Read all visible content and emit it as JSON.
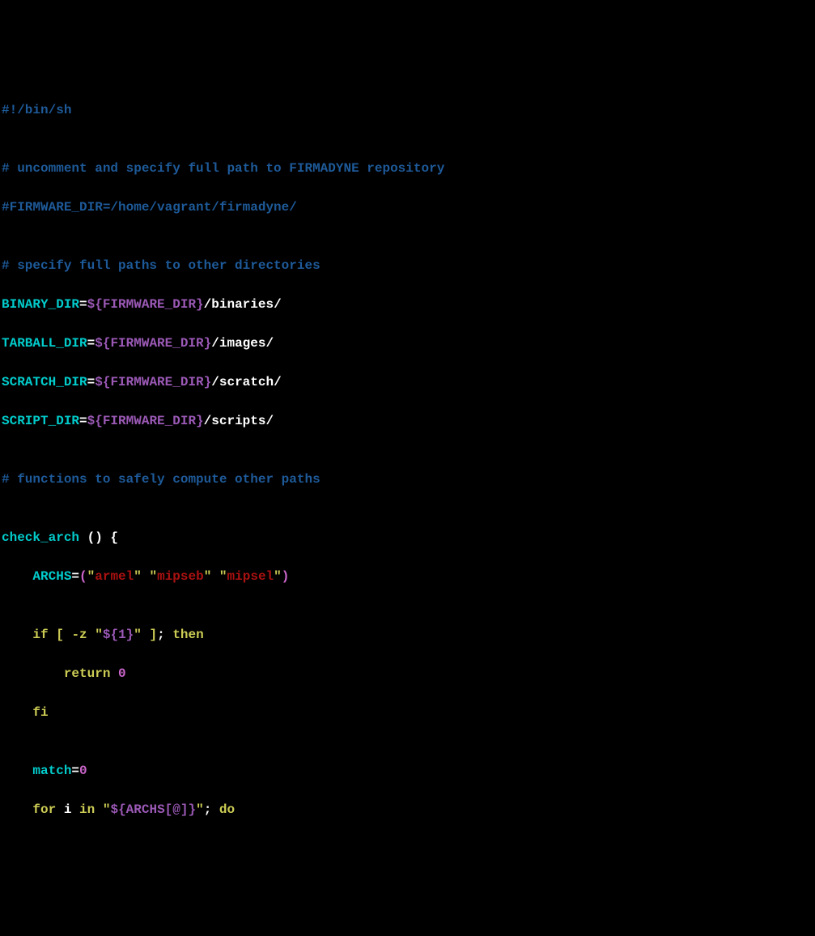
{
  "lines": {
    "l1_shebang": "#!/bin/sh",
    "l2_blank": "",
    "l3_comment": "# uncomment and specify full path to FIRMADYNE repository",
    "l4_comment": "#FIRMWARE_DIR=/home/vagrant/firmadyne/",
    "l5_blank": "",
    "l6_comment": "# specify full paths to other directories",
    "l7_var": "BINARY_DIR",
    "l7_eq": "=",
    "l7_exp": "${FIRMWARE_DIR}",
    "l7_tail": "/binaries/",
    "l8_var": "TARBALL_DIR",
    "l8_eq": "=",
    "l8_exp": "${FIRMWARE_DIR}",
    "l8_tail": "/images/",
    "l9_var": "SCRATCH_DIR",
    "l9_eq": "=",
    "l9_exp": "${FIRMWARE_DIR}",
    "l9_tail": "/scratch/",
    "l10_var": "SCRIPT_DIR",
    "l10_eq": "=",
    "l10_exp": "${FIRMWARE_DIR}",
    "l10_tail": "/scripts/",
    "l11_blank": "",
    "l12_comment": "# functions to safely compute other paths",
    "l13_blank": "",
    "l14_func": "check_arch ",
    "l14_paren": "()",
    "l14_brace": " {",
    "l15_indent": "    ",
    "l15_var": "ARCHS",
    "l15_eq": "=",
    "l15_popen": "(",
    "l15_q1a": "\"",
    "l15_s1": "armel",
    "l15_q1b": "\"",
    "l15_sp1": " ",
    "l15_q2a": "\"",
    "l15_s2": "mipseb",
    "l15_q2b": "\"",
    "l15_sp2": " ",
    "l15_q3a": "\"",
    "l15_s3": "mipsel",
    "l15_q3b": "\"",
    "l15_pclose": ")",
    "l16_blank": "",
    "l17_indent": "    ",
    "l17_if": "if",
    "l17_sp1": " ",
    "l17_br1": "[",
    "l17_sp2": " ",
    "l17_flag": "-z ",
    "l17_q1": "\"",
    "l17_exp": "${1}",
    "l17_q2": "\"",
    "l17_sp3": " ",
    "l17_br2": "]",
    "l17_semi": ";",
    "l17_sp4": " ",
    "l17_then": "then",
    "l18_indent": "        ",
    "l18_return": "return",
    "l18_sp": " ",
    "l18_zero": "0",
    "l19_indent": "    ",
    "l19_fi": "fi",
    "l20_blank": "",
    "l21_indent": "    ",
    "l21_var": "match",
    "l21_eq": "=",
    "l21_zero": "0",
    "l22_indent": "    ",
    "l22_for": "for",
    "l22_sp1": " ",
    "l22_i": "i",
    "l22_sp2": " ",
    "l22_in": "in",
    "l22_sp3": " ",
    "l22_q1": "\"",
    "l22_exp": "${ARCHS[@]}",
    "l22_q2": "\"",
    "l22_semi": ";",
    "l22_sp4": " ",
    "l22_do": "do"
  }
}
